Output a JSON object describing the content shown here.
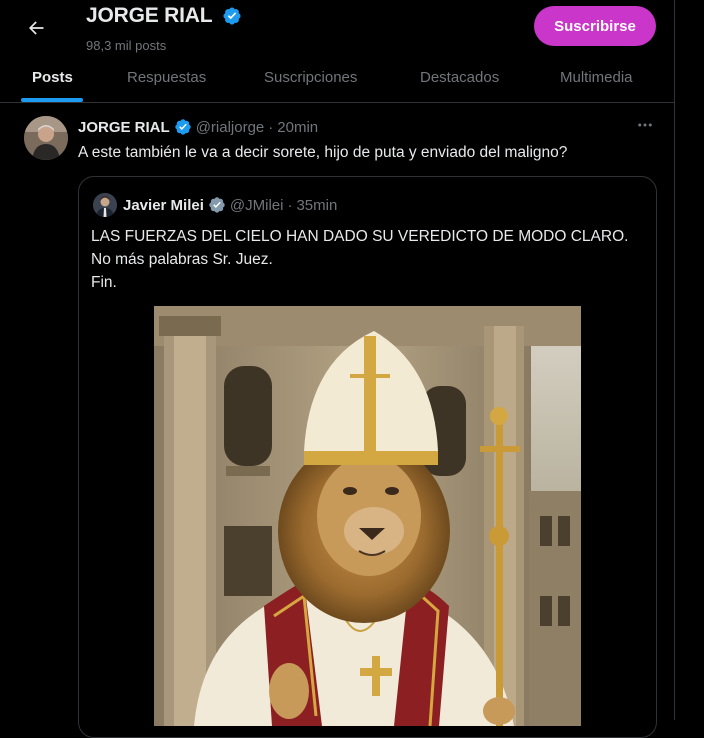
{
  "header": {
    "back_label": "back",
    "title": "JORGE RIAL",
    "post_count": "98,3 mil posts",
    "subscribe_label": "Suscribirse",
    "accent_color": "#c936c9"
  },
  "tabs": [
    {
      "label": "Posts",
      "active": true
    },
    {
      "label": "Respuestas",
      "active": false
    },
    {
      "label": "Suscripciones",
      "active": false
    },
    {
      "label": "Destacados",
      "active": false
    },
    {
      "label": "Multimedia",
      "active": false
    }
  ],
  "post": {
    "author_name": "JORGE RIAL",
    "handle": "@rialjorge",
    "separator": "·",
    "time": "20min",
    "text": "A este también le va a decir sorete, hijo de puta y enviado del maligno?",
    "more_icon": "more-horizontal-icon",
    "verified_color": "#1d9bf0"
  },
  "quoted_post": {
    "author_name": "Javier Milei",
    "handle": "@JMilei",
    "separator": "·",
    "time": "35min",
    "lines": [
      "LAS FUERZAS DEL CIELO HAN DADO SU VEREDICTO DE MODO CLARO.",
      "No más palabras Sr. Juez.",
      "Fin."
    ],
    "verified_color": "#829aab",
    "image_icon": "lion-pope-image"
  },
  "colors": {
    "background": "#000000",
    "text": "#e7e9ea",
    "muted": "#71767b",
    "border": "#2f3336",
    "tab_indicator": "#1d9bf0"
  }
}
